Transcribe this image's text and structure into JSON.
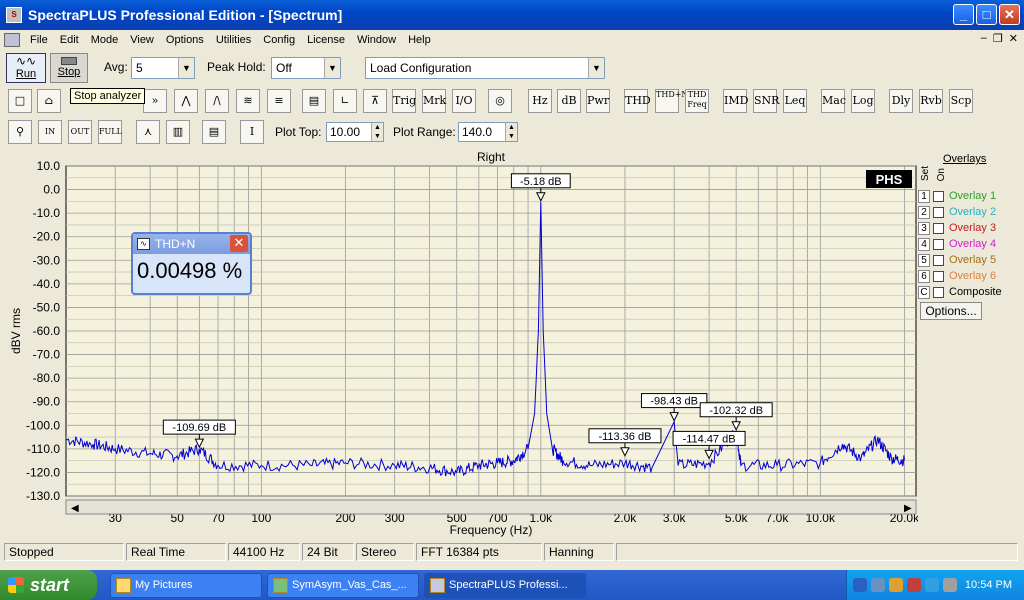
{
  "window": {
    "title": "SpectraPLUS Professional Edition - [Spectrum]"
  },
  "menu": [
    "File",
    "Edit",
    "Mode",
    "View",
    "Options",
    "Utilities",
    "Config",
    "License",
    "Window",
    "Help"
  ],
  "toolbar1": {
    "run_label": "Run",
    "stop_label": "Stop",
    "avg_label": "Avg:",
    "avg_value": "5",
    "peakhold_label": "Peak Hold:",
    "peakhold_value": "Off",
    "config_value": "Load Configuration",
    "tooltip": "Stop analyzer"
  },
  "toolbar2": {
    "buttons": [
      "Trig",
      "Mrk",
      "I/O",
      "Hz",
      "dB",
      "Pwr",
      "THD",
      "THD+N",
      "THD Freq",
      "IMD",
      "SNR",
      "Leq",
      "Mac",
      "Log",
      "Dly",
      "Rvb",
      "Scp"
    ]
  },
  "toolbar3": {
    "plot_top_label": "Plot Top:",
    "plot_top_value": "10.00",
    "plot_range_label": "Plot Range:",
    "plot_range_value": "140.0"
  },
  "overlays": {
    "title": "Overlays",
    "set_label": "Set",
    "on_label": "On",
    "items": [
      {
        "num": "1",
        "label": "Overlay 1",
        "color": "#2e9e2e"
      },
      {
        "num": "2",
        "label": "Overlay 2",
        "color": "#2ab0c0"
      },
      {
        "num": "3",
        "label": "Overlay 3",
        "color": "#c02020"
      },
      {
        "num": "4",
        "label": "Overlay 4",
        "color": "#d020d0"
      },
      {
        "num": "5",
        "label": "Overlay 5",
        "color": "#a07010"
      },
      {
        "num": "6",
        "label": "Overlay 6",
        "color": "#e08040"
      },
      {
        "num": "C",
        "label": "Composite",
        "color": "#000000"
      }
    ],
    "options_label": "Options..."
  },
  "thd_window": {
    "title": "THD+N",
    "value": "0.00498 %"
  },
  "status": [
    "Stopped",
    "Real Time",
    "44100 Hz",
    "24 Bit",
    "Stereo",
    "FFT 16384 pts",
    "Hanning"
  ],
  "taskbar": {
    "start": "start",
    "tasks": [
      "My Pictures",
      "SymAsym_Vas_Cas_...",
      "SpectraPLUS Professi..."
    ],
    "clock": "10:54 PM"
  },
  "chart_data": {
    "type": "line",
    "title": "Right",
    "xlabel": "Frequency (Hz)",
    "ylabel": "dBV rms",
    "xscale": "log",
    "xlim": [
      20,
      22000
    ],
    "ylim": [
      -130,
      10
    ],
    "x_ticks": [
      "30",
      "50",
      "70",
      "100",
      "200",
      "300",
      "500",
      "700",
      "1.0k",
      "2.0k",
      "3.0k",
      "5.0k",
      "7.0k",
      "10.0k",
      "20.0k"
    ],
    "x_tick_values": [
      30,
      50,
      70,
      100,
      200,
      300,
      500,
      700,
      1000,
      2000,
      3000,
      5000,
      7000,
      10000,
      20000
    ],
    "y_ticks": [
      "10.0",
      "0.0",
      "-10.0",
      "-20.0",
      "-30.0",
      "-40.0",
      "-50.0",
      "-60.0",
      "-70.0",
      "-80.0",
      "-90.0",
      "-100.0",
      "-110.0",
      "-120.0",
      "-130.0"
    ],
    "grid": true,
    "logo": "PHS",
    "series": [
      {
        "color": "#0000d0",
        "points": [
          [
            20,
            -106
          ],
          [
            25,
            -108
          ],
          [
            30,
            -110
          ],
          [
            40,
            -112
          ],
          [
            50,
            -113
          ],
          [
            60,
            -110
          ],
          [
            70,
            -117
          ],
          [
            100,
            -117
          ],
          [
            150,
            -117
          ],
          [
            200,
            -116
          ],
          [
            300,
            -117
          ],
          [
            400,
            -118
          ],
          [
            500,
            -120
          ],
          [
            600,
            -117
          ],
          [
            700,
            -116
          ],
          [
            800,
            -115
          ],
          [
            900,
            -110
          ],
          [
            950,
            -95
          ],
          [
            980,
            -60
          ],
          [
            1000,
            -5.18
          ],
          [
            1020,
            -60
          ],
          [
            1050,
            -95
          ],
          [
            1100,
            -110
          ],
          [
            1200,
            -115
          ],
          [
            1500,
            -117
          ],
          [
            2000,
            -116
          ],
          [
            2500,
            -118
          ],
          [
            3000,
            -98.43
          ],
          [
            3100,
            -117
          ],
          [
            4000,
            -116
          ],
          [
            5000,
            -102.32
          ],
          [
            5200,
            -117
          ],
          [
            7000,
            -117
          ],
          [
            10000,
            -116
          ],
          [
            12000,
            -108
          ],
          [
            14000,
            -114
          ],
          [
            16000,
            -106
          ],
          [
            18000,
            -114
          ],
          [
            20000,
            -115
          ]
        ]
      }
    ],
    "markers": [
      {
        "x": 60,
        "y": -109.69,
        "label": "-109.69 dB"
      },
      {
        "x": 1000,
        "y": -5.18,
        "label": "-5.18 dB"
      },
      {
        "x": 2000,
        "y": -113.36,
        "label": "-113.36 dB"
      },
      {
        "x": 3000,
        "y": -98.43,
        "label": "-98.43 dB"
      },
      {
        "x": 4000,
        "y": -114.47,
        "label": "-114.47 dB"
      },
      {
        "x": 5000,
        "y": -102.32,
        "label": "-102.32 dB"
      }
    ]
  }
}
